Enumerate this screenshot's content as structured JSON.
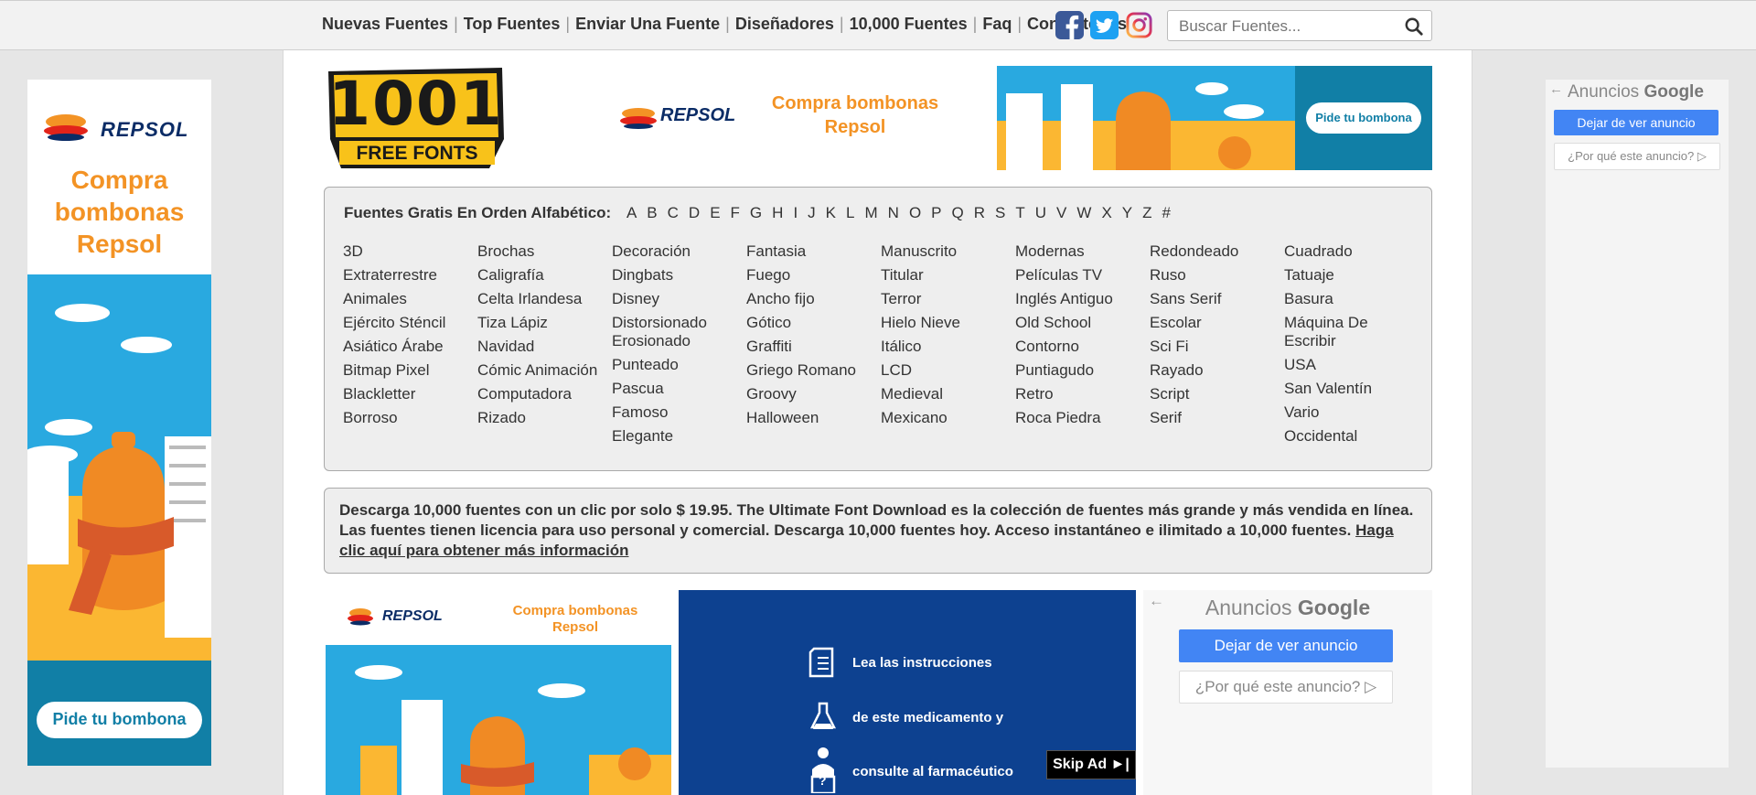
{
  "nav": {
    "items": [
      "Nuevas Fuentes",
      "Top Fuentes",
      "Enviar Una Fuente",
      "Diseñadores",
      "10,000 Fuentes",
      "Faq",
      "Contáctenos"
    ]
  },
  "social": [
    "facebook-icon",
    "twitter-icon",
    "instagram-icon"
  ],
  "search": {
    "placeholder": "Buscar Fuentes..."
  },
  "logo": {
    "line1": "1001",
    "line2": "FREE FONTS"
  },
  "ads": {
    "brand": "REPSOL",
    "headline_left": "Compra bombonas Repsol",
    "headline_banner": "Compra bombonas Repsol",
    "cta": "Pide tu bombona",
    "google_label": "Anuncios",
    "google_word": "Google",
    "stop_ad": "Dejar de ver anuncio",
    "why_ad": "¿Por qué este anuncio?",
    "med_lines": [
      "Lea las instrucciones",
      "de este medicamento y",
      "consulte al farmacéutico"
    ],
    "skip": "Skip Ad"
  },
  "alphabet": {
    "label": "Fuentes Gratis En Orden Alfabético:",
    "letters": [
      "A",
      "B",
      "C",
      "D",
      "E",
      "F",
      "G",
      "H",
      "I",
      "J",
      "K",
      "L",
      "M",
      "N",
      "O",
      "P",
      "Q",
      "R",
      "S",
      "T",
      "U",
      "V",
      "W",
      "X",
      "Y",
      "Z",
      "#"
    ]
  },
  "categories": [
    [
      "3D",
      "Extraterrestre",
      "Animales",
      "Ejército Sténcil",
      "Asiático Árabe",
      "Bitmap Pixel",
      "Blackletter",
      "Borroso"
    ],
    [
      "Brochas",
      "Caligrafía",
      "Celta Irlandesa",
      "Tiza Lápiz",
      "Navidad",
      "Cómic Animación",
      "Computadora",
      "Rizado"
    ],
    [
      "Decoración",
      "Dingbats",
      "Disney",
      "Distorsionado Erosionado",
      "Punteado",
      "Pascua",
      "Famoso",
      "Elegante"
    ],
    [
      "Fantasia",
      "Fuego",
      "Ancho fijo",
      "Gótico",
      "Graffiti",
      "Griego Romano",
      "Groovy",
      "Halloween"
    ],
    [
      "Manuscrito",
      "Titular",
      "Terror",
      "Hielo Nieve",
      "Itálico",
      "LCD",
      "Medieval",
      "Mexicano"
    ],
    [
      "Modernas",
      "Películas TV",
      "Inglés Antiguo",
      "Old School",
      "Contorno",
      "Puntiagudo",
      "Retro",
      "Roca Piedra"
    ],
    [
      "Redondeado",
      "Ruso",
      "Sans Serif",
      "Escolar",
      "Sci Fi",
      "Rayado",
      "Script",
      "Serif"
    ],
    [
      "Cuadrado",
      "Tatuaje",
      "Basura",
      "Máquina De Escribir",
      "USA",
      "San Valentín",
      "Vario",
      "Occidental"
    ]
  ],
  "promo": {
    "text": "Descarga 10,000 fuentes con un clic por solo $ 19.95. The Ultimate Font Download es la colección de fuentes más grande y más vendida en línea. Las fuentes tienen licencia para uso personal y comercial. Descarga 10,000 fuentes hoy. Acceso instantáneo e ilimitado a 10,000 fuentes.",
    "link": "Haga clic aquí para obtener más información"
  },
  "colors": {
    "repsol_orange": "#f39325",
    "ad_blue": "#0f9bd7",
    "google_blue": "#4285f4",
    "med_blue": "#0d4190"
  }
}
